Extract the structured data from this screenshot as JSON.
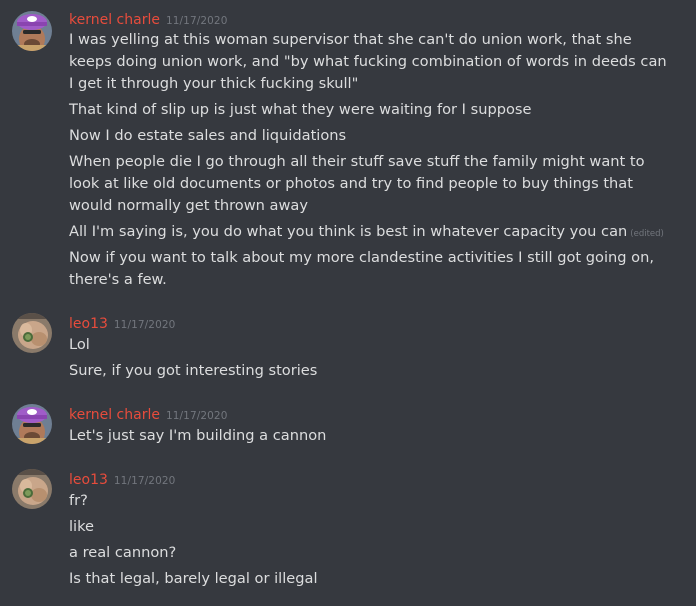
{
  "colors": {
    "background": "#36393f",
    "username": "#e74c3c",
    "timestamp": "#72767d",
    "text": "#dcddde"
  },
  "messages": [
    {
      "author": "kernel charle",
      "timestamp": "11/17/2020",
      "avatar": "purple-cap-avatar",
      "lines": [
        "I was yelling at this woman supervisor that she can't do union work, that she keeps doing union work, and \"by what fucking combination of words in deeds can I get it through your thick fucking skull\"",
        "That kind of slip up is just what they were waiting for I suppose",
        "Now I do estate sales and liquidations",
        "When people die I go through all their stuff save stuff the family might want to look at like old documents or photos and try to find people to buy things that would normally get thrown away",
        "All I'm saying is, you do what you think is best in whatever capacity you can",
        "Now if you want to talk about my more clandestine activities I still got going on, there's a few."
      ],
      "edited_label": "(edited)"
    },
    {
      "author": "leo13",
      "timestamp": "11/17/2020",
      "avatar": "hand-ring-avatar",
      "lines": [
        "Lol",
        "Sure, if you got interesting stories"
      ]
    },
    {
      "author": "kernel charle",
      "timestamp": "11/17/2020",
      "avatar": "purple-cap-avatar",
      "lines": [
        "Let's just say I'm building a cannon"
      ]
    },
    {
      "author": "leo13",
      "timestamp": "11/17/2020",
      "avatar": "hand-ring-avatar",
      "lines": [
        "fr?",
        "like",
        "a real cannon?",
        "Is that legal, barely legal or illegal"
      ]
    }
  ]
}
